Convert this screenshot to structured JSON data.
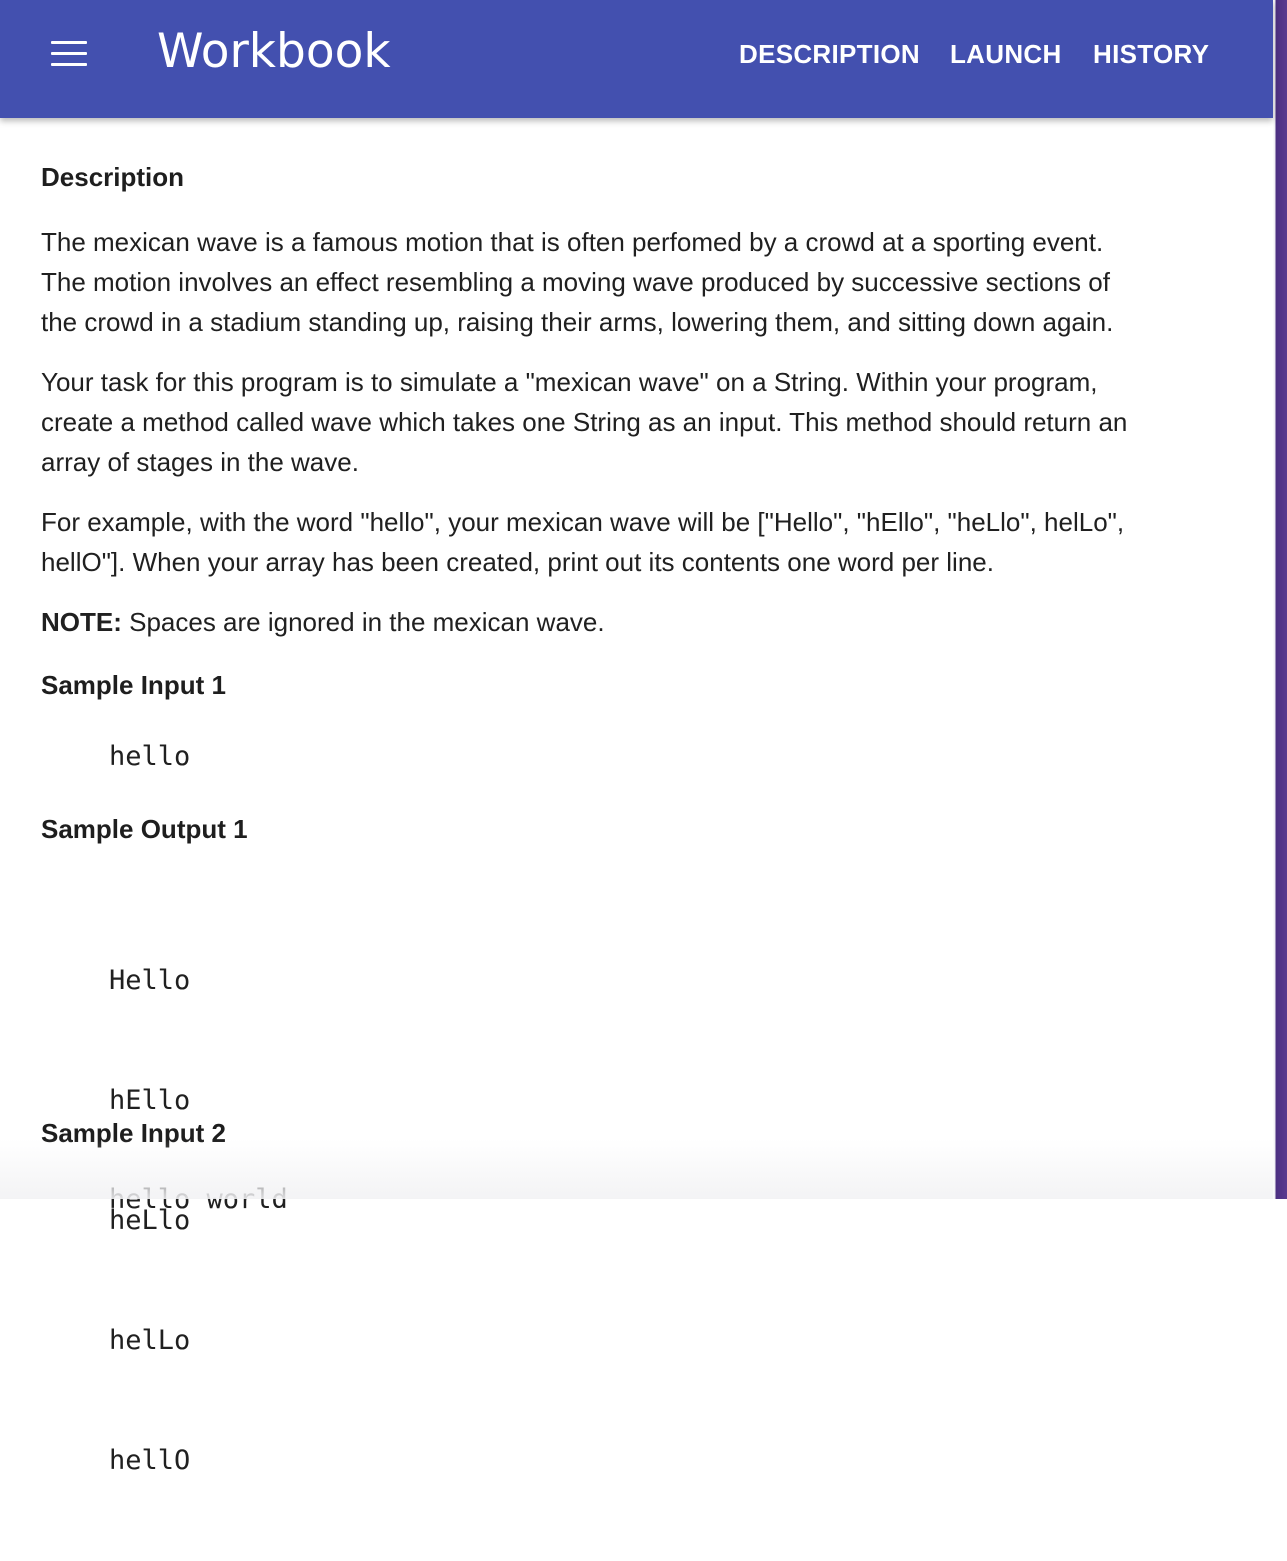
{
  "app": {
    "title": "Workbook",
    "menu_icon": "hamburger-menu-icon",
    "brand_color": "#4350af"
  },
  "nav": {
    "description": "DESCRIPTION",
    "launch": "LAUNCH",
    "history": "HISTORY"
  },
  "content": {
    "heading": "Description",
    "paragraph1": [
      "The mexican wave is a famous motion that is often perfomed by a crowd at a sporting event.",
      "The motion involves an effect resembling a moving wave produced by successive sections of",
      "the crowd in a stadium standing up, raising their arms, lowering them, and sitting down again."
    ],
    "paragraph2": [
      "Your task for this program is to simulate a \"mexican wave\" on a String. Within your program,",
      "create a method called wave which takes one String as an input. This method should return an",
      "array of stages in the wave."
    ],
    "paragraph3": [
      "For example, with the word \"hello\", your mexican wave will be [\"Hello\", \"hEllo\", \"heLlo\", helLo\",",
      "hellO\"]. When your array has been created, print out its contents one word per line."
    ],
    "note_label": "NOTE:",
    "note_text": " Spaces are ignored in the mexican wave.",
    "sample_input_1_heading": "Sample Input 1",
    "sample_input_1": "hello",
    "sample_output_1_heading": "Sample Output 1",
    "sample_output_1": [
      "Hello",
      "hEllo",
      "heLlo",
      "helLo",
      "hellO"
    ],
    "sample_input_2_heading": "Sample Input 2",
    "sample_input_2_partial": "hello world"
  }
}
